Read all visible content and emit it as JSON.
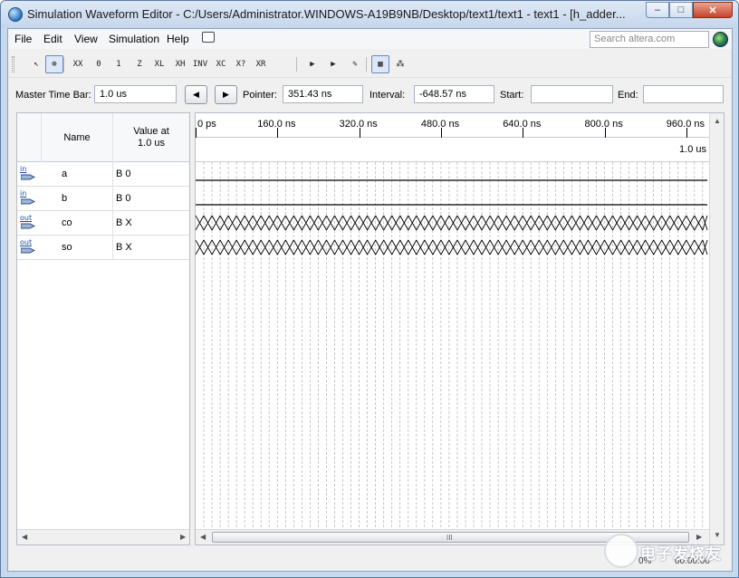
{
  "window": {
    "title": "Simulation Waveform Editor - C:/Users/Administrator.WINDOWS-A19B9NB/Desktop/text1/text1 - text1 - [h_adder...",
    "minimize": "–",
    "maximize": "□",
    "close": "✕"
  },
  "menu": {
    "file": "File",
    "edit": "Edit",
    "view": "View",
    "simulation": "Simulation",
    "help": "Help",
    "search_placeholder": "Search altera.com"
  },
  "toolbar": {
    "tools": [
      {
        "name": "selection-tool-icon",
        "glyph": "↖"
      },
      {
        "name": "zoom-tool-icon",
        "glyph": "⊕"
      },
      {
        "name": "force-unknown-icon",
        "glyph": "XX"
      },
      {
        "name": "force-low-icon",
        "glyph": "0"
      },
      {
        "name": "force-high-icon",
        "glyph": "1"
      },
      {
        "name": "force-high-impedance-icon",
        "glyph": "Z"
      },
      {
        "name": "force-weak-low-icon",
        "glyph": "XL"
      },
      {
        "name": "force-weak-high-icon",
        "glyph": "XH"
      },
      {
        "name": "invert-icon",
        "glyph": "INV"
      },
      {
        "name": "count-value-icon",
        "glyph": "XC"
      },
      {
        "name": "force-dont-care-icon",
        "glyph": "X?"
      },
      {
        "name": "random-value-icon",
        "glyph": "XR"
      },
      {
        "name": "run-functional-simulation-icon",
        "glyph": "▶"
      },
      {
        "name": "run-timing-simulation-icon",
        "glyph": "▶"
      },
      {
        "name": "generate-netlist-icon",
        "glyph": "✎"
      },
      {
        "name": "snap-to-grid-icon",
        "glyph": "▦"
      },
      {
        "name": "waveform-settings-icon",
        "glyph": "⁂"
      }
    ]
  },
  "timebar": {
    "master_label": "Master Time Bar:",
    "master_value": "1.0 us",
    "pointer_label": "Pointer:",
    "pointer_value": "351.43 ns",
    "interval_label": "Interval:",
    "interval_value": "-648.57 ns",
    "start_label": "Start:",
    "start_value": "",
    "end_label": "End:",
    "end_value": "",
    "prev_glyph": "◀",
    "next_glyph": "▶"
  },
  "signals_header": {
    "name": "Name",
    "value_line1": "Value at",
    "value_line2": "1.0 us"
  },
  "signals": [
    {
      "direction": "in",
      "name": "a",
      "value": "B 0",
      "wave": "low"
    },
    {
      "direction": "in",
      "name": "b",
      "value": "B 0",
      "wave": "low"
    },
    {
      "direction": "out",
      "name": "co",
      "value": "B X",
      "wave": "unknown"
    },
    {
      "direction": "out",
      "name": "so",
      "value": "B X",
      "wave": "unknown"
    }
  ],
  "ruler": {
    "ticks": [
      "0 ps",
      "160.0 ns",
      "320.0 ns",
      "480.0 ns",
      "640.0 ns",
      "800.0 ns",
      "960.0 ns"
    ],
    "master_marker": "1.0 us"
  },
  "scroll": {
    "left": "◀",
    "right": "▶",
    "up": "▲",
    "down": "▼",
    "thumb_grip": "III"
  },
  "status": {
    "zoom_fragment": "0%",
    "time": "00:00:00"
  },
  "colors": {
    "titlebar": "#c5d6ec",
    "input_icon": "#1d4fa0",
    "wave_stroke": "#000000",
    "grid": "#b0b0b0"
  }
}
